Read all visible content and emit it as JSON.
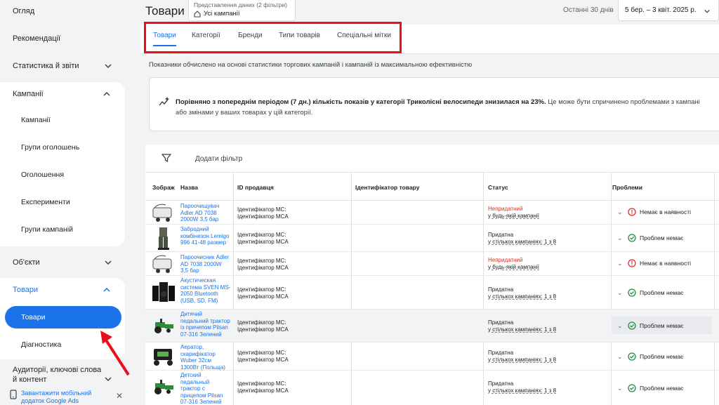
{
  "sidebar": {
    "overview": "Огляд",
    "recommendations": "Рекомендації",
    "stats": "Статистика й звіти",
    "campaigns_group": {
      "title": "Кампанії",
      "items": [
        "Кампанії",
        "Групи оголошень",
        "Оголошення",
        "Експерименти",
        "Групи кампаній"
      ]
    },
    "objects": "Об'єкти",
    "products_group": {
      "title": "Товари",
      "active": "Товари",
      "diagnostics": "Діагностика"
    },
    "audiences": "Аудиторії, ключові слова й контент",
    "download": "Завантажити мобільний додаток Google Ads"
  },
  "header": {
    "title": "Товари",
    "view_label": "Представлення даних (2 фільтри)",
    "view_value": "Усі кампанії",
    "period": "Останні 30 днів",
    "date_range": "5 бер. – 3 квіт. 2025 р."
  },
  "tabs": [
    "Товари",
    "Категорії",
    "Бренди",
    "Типи товарів",
    "Спеціальні мітки"
  ],
  "info_line": "Показники обчислено на основі статистики торгових кампаній і кампаній із максимальною ефективністю",
  "insight": {
    "bold": "Порівняно з попереднім періодом (7 дн.) кількість показів у категорії Триколісні велосипеди знизилася на 23%.",
    "rest": " Це може бути спричинено проблемами з кампані",
    "line2": "або змінами у ваших товарах у цій категорії."
  },
  "table": {
    "add_filter": "Додати фільтр",
    "columns": [
      "Зображ",
      "Назва",
      "ID продавця",
      "Ідентифікатор товару",
      "Статус",
      "Проблеми"
    ],
    "rows": [
      {
        "name": "Пароочищувач Adler AD 7038 2000W 3,5 бар",
        "id1": "Ідентифікатор MC:",
        "id2": "Ідентифікатор MCA",
        "status": "Непридатний",
        "status_note": "у будь-якій кампанії",
        "problem": "Немає в наявності"
      },
      {
        "name": "Забродний комбінезон Lemigo 996 41-48 размер",
        "id1": "Ідентифікатор MC:",
        "id2": "Ідентифікатор MCA",
        "status": "Придатна",
        "status_note": "у стількох кампаніях: 1 з 8",
        "problem": "Проблем немає"
      },
      {
        "name": "Пароочисник Adler AD 7038 2000W 3,5 бар",
        "id1": "Ідентифікатор MC:",
        "id2": "Ідентифікатор MCA",
        "status": "Непридатний",
        "status_note": "у будь-якій кампанії",
        "problem": "Немає в наявності"
      },
      {
        "name": "Акустическая система SVEN MS-2050 Bluetooth (USB, SD, FM)",
        "id1": "Ідентифікатор MC:",
        "id2": "Ідентифікатор MCA",
        "status": "Придатна",
        "status_note": "у стількох кампаніях: 1 з 8",
        "problem": "Проблем немає"
      },
      {
        "name": "Дитячий педальний трактор із причепом Pilsan 07-316 Зелений",
        "id1": "Ідентифікатор MC:",
        "id2": "Ідентифікатор MCA",
        "status": "Придатна",
        "status_note": "у стількох кампаніях: 1 з 8",
        "problem": "Проблем немає"
      },
      {
        "name": "Аератор, скарифікатор Wuber 32см 1300Вт (Польща)",
        "id1": "Ідентифікатор MC:",
        "id2": "Ідентифікатор MCA",
        "status": "Придатна",
        "status_note": "у стількох кампаніях: 1 з 8",
        "problem": "Проблем немає"
      },
      {
        "name": "Детский педальный трактор с прицепом Pilsan 07-316 Зелений",
        "id1": "Ідентифікатор MC:",
        "id2": "Ідентифікатор MCA",
        "status": "Придатна",
        "status_note": "у стількох кампаніях: 1 з 8",
        "problem": "Проблем немає"
      }
    ]
  },
  "colors": {
    "accent": "#1a73e8",
    "error": "#d93025",
    "ok": "#1e8e3e",
    "highlight": "#e8111b"
  }
}
